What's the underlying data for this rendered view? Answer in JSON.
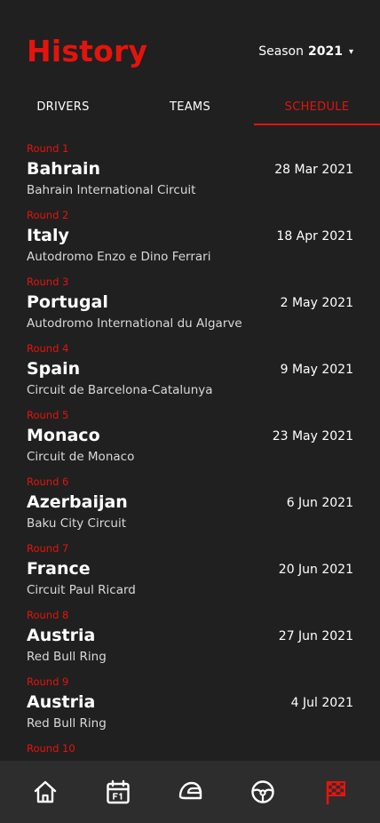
{
  "header": {
    "title": "History",
    "season_label": "Season",
    "season_value": "2021",
    "season_caret": "▾"
  },
  "tabs": [
    {
      "label": "DRIVERS",
      "active": false
    },
    {
      "label": "TEAMS",
      "active": false
    },
    {
      "label": "SCHEDULE",
      "active": true
    }
  ],
  "races": [
    {
      "round": "Round 1",
      "name": "Bahrain",
      "date": "28 Mar 2021",
      "circuit": "Bahrain International Circuit"
    },
    {
      "round": "Round 2",
      "name": "Italy",
      "date": "18 Apr 2021",
      "circuit": "Autodromo Enzo e Dino Ferrari"
    },
    {
      "round": "Round 3",
      "name": "Portugal",
      "date": "2 May 2021",
      "circuit": "Autodromo International du Algarve"
    },
    {
      "round": "Round 4",
      "name": "Spain",
      "date": "9 May 2021",
      "circuit": "Circuit de Barcelona-Catalunya"
    },
    {
      "round": "Round 5",
      "name": "Monaco",
      "date": "23 May 2021",
      "circuit": "Circuit de Monaco"
    },
    {
      "round": "Round 6",
      "name": "Azerbaijan",
      "date": "6 Jun 2021",
      "circuit": "Baku City Circuit"
    },
    {
      "round": "Round 7",
      "name": "France",
      "date": "20 Jun 2021",
      "circuit": "Circuit Paul Ricard"
    },
    {
      "round": "Round 8",
      "name": "Austria",
      "date": "27 Jun 2021",
      "circuit": "Red Bull Ring"
    },
    {
      "round": "Round 9",
      "name": "Austria",
      "date": "4 Jul 2021",
      "circuit": "Red Bull Ring"
    },
    {
      "round": "Round 10",
      "name": "",
      "date": "",
      "circuit": ""
    }
  ],
  "bottom_nav": [
    {
      "icon": "home-icon",
      "active": false
    },
    {
      "icon": "calendar-icon",
      "active": false
    },
    {
      "icon": "helmet-icon",
      "active": false
    },
    {
      "icon": "steering-wheel-icon",
      "active": false
    },
    {
      "icon": "checkered-flag-icon",
      "active": true
    }
  ],
  "colors": {
    "accent": "#e3140d",
    "background": "#202020",
    "nav_background": "#2d2d2d",
    "text": "#ffffff",
    "subtext": "#d9d9d9"
  }
}
